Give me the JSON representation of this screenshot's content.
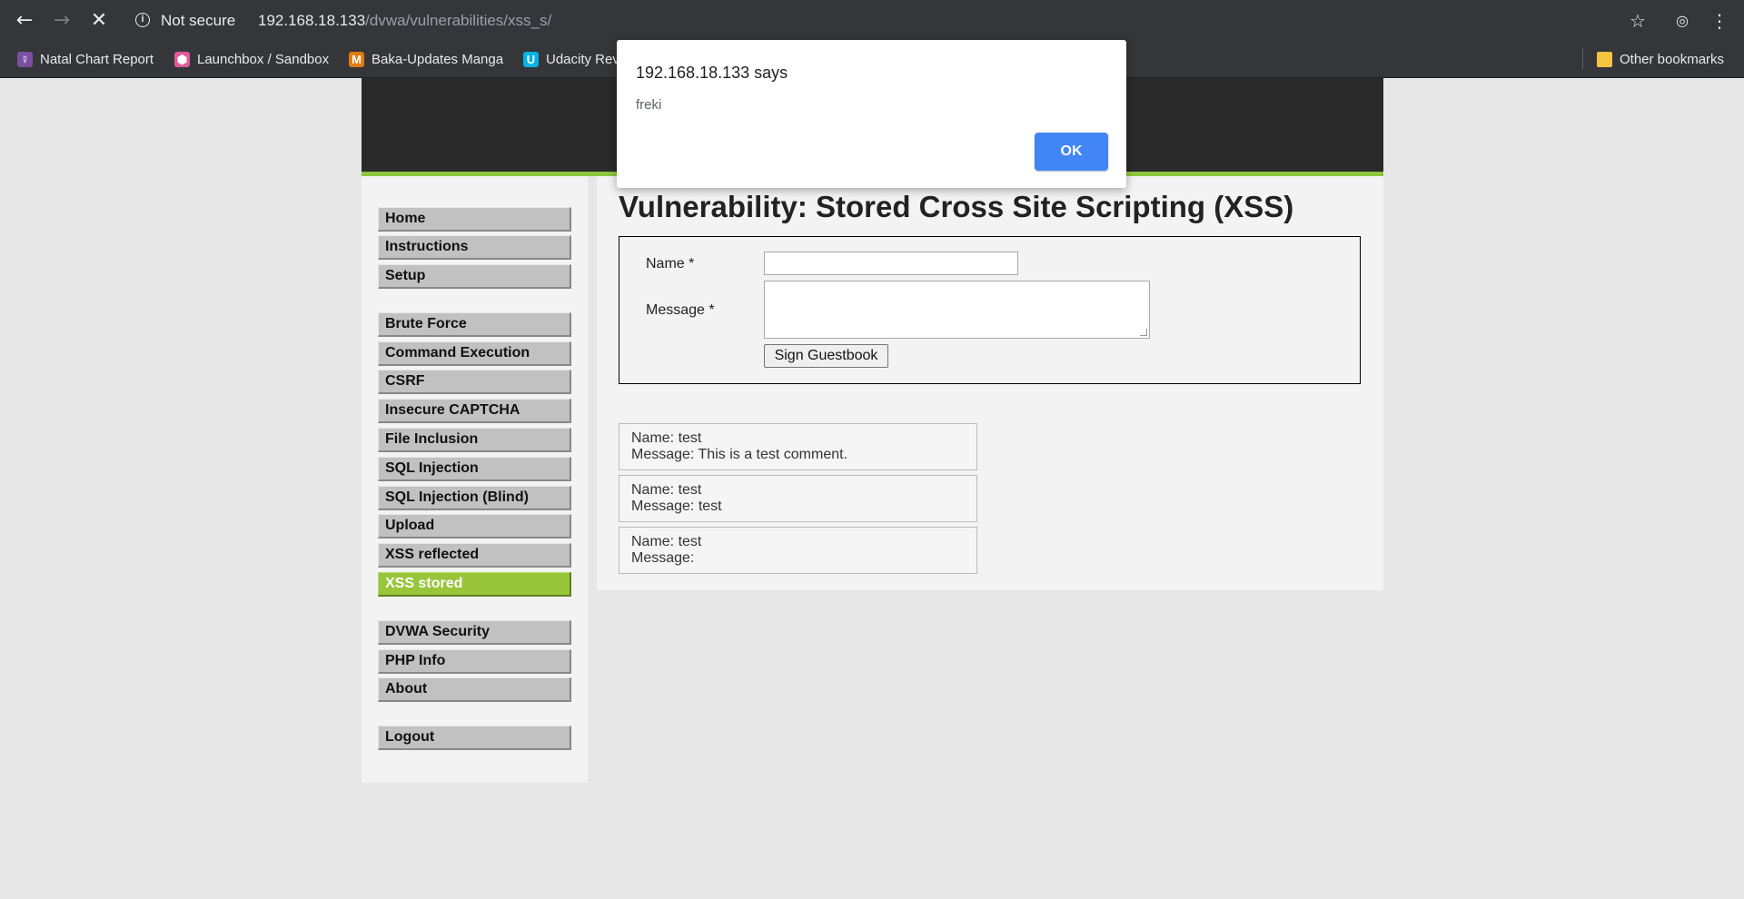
{
  "browser": {
    "security_label": "Not secure",
    "url_host": "192.168.18.133",
    "url_path": "/dvwa/vulnerabilities/xss_s/",
    "bookmarks": [
      {
        "label": "Natal Chart Report",
        "icon": "astro-icon",
        "color": "#7b4fa0"
      },
      {
        "label": "Launchbox / Sandbox",
        "icon": "launchbox-icon",
        "color": "#e05a9c"
      },
      {
        "label": "Baka-Updates Manga",
        "icon": "manga-icon",
        "color": "#e07b12"
      },
      {
        "label": "Udacity Rev",
        "icon": "udacity-icon",
        "color": "#02b3e4"
      }
    ],
    "other_bookmarks": "Other bookmarks"
  },
  "dialog": {
    "title": "192.168.18.133 says",
    "message": "freki",
    "ok_label": "OK"
  },
  "menu": {
    "group1": [
      "Home",
      "Instructions",
      "Setup"
    ],
    "group2": [
      "Brute Force",
      "Command Execution",
      "CSRF",
      "Insecure CAPTCHA",
      "File Inclusion",
      "SQL Injection",
      "SQL Injection (Blind)",
      "Upload",
      "XSS reflected",
      "XSS stored"
    ],
    "group3": [
      "DVWA Security",
      "PHP Info",
      "About"
    ],
    "group4": [
      "Logout"
    ],
    "active": "XSS stored"
  },
  "page": {
    "title": "Vulnerability: Stored Cross Site Scripting (XSS)",
    "name_label": "Name *",
    "message_label": "Message *",
    "name_value": "",
    "message_value": "",
    "submit_label": "Sign Guestbook"
  },
  "entries": [
    {
      "name": "Name: test",
      "message": "Message: This is a test comment."
    },
    {
      "name": "Name: test",
      "message": "Message: test"
    },
    {
      "name": "Name: test",
      "message": "Message:"
    }
  ],
  "colors": {
    "accent_green": "#8dc63f",
    "active_menu": "#98c53a",
    "dialog_button": "#4285f4"
  }
}
